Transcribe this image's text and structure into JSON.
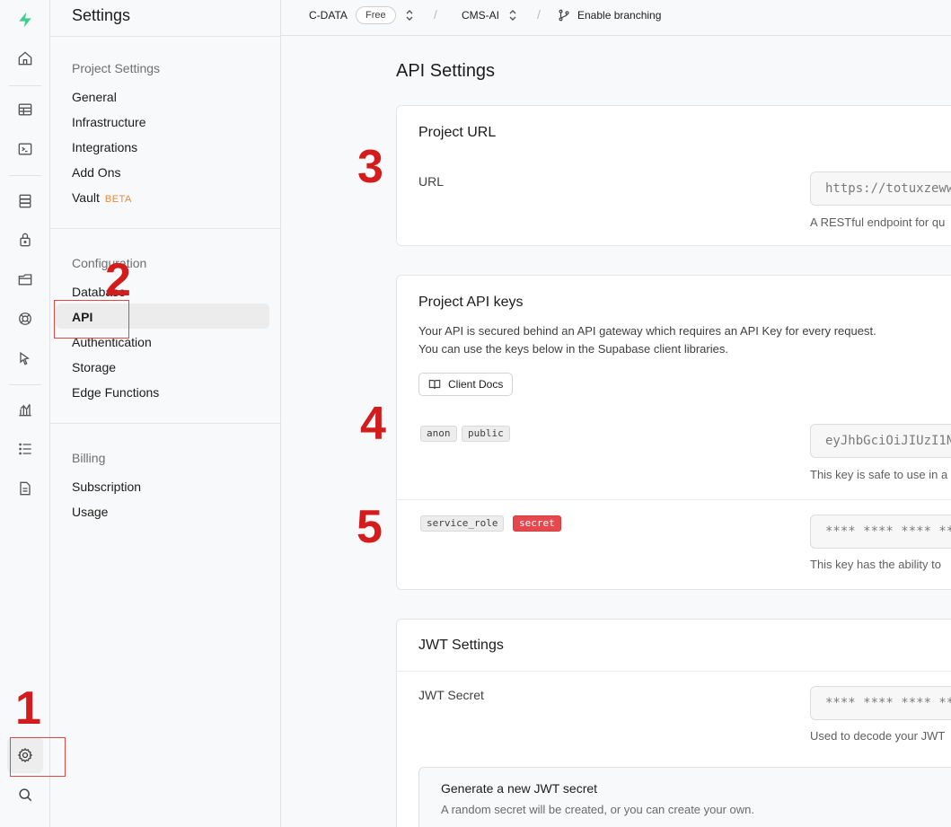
{
  "app": {
    "brand_color": "#3ecf8e"
  },
  "rail": {
    "icons": [
      "home-icon",
      "table-editor-icon",
      "sql-editor-icon",
      "database-icon",
      "auth-lock-icon",
      "storage-icon",
      "realtime-icon",
      "edge-functions-icon",
      "reports-icon",
      "logs-icon",
      "docs-icon",
      "settings-icon",
      "search-icon"
    ]
  },
  "menu": {
    "title": "Settings",
    "project_section": "Project Settings",
    "project_items": [
      "General",
      "Infrastructure",
      "Integrations",
      "Add Ons",
      "Vault"
    ],
    "vault_badge": "BETA",
    "config_section": "Configuration",
    "config_items": [
      "Database",
      "API",
      "Authentication",
      "Storage",
      "Edge Functions"
    ],
    "active_item": "API",
    "billing_section": "Billing",
    "billing_items": [
      "Subscription",
      "Usage"
    ]
  },
  "topbar": {
    "org": "C-DATA",
    "plan": "Free",
    "project": "CMS-AI",
    "branching": "Enable branching"
  },
  "main": {
    "title": "API Settings",
    "project_url": {
      "title": "Project URL",
      "label": "URL",
      "value": "https://totuxzeww",
      "help": "A RESTful endpoint for qu"
    },
    "api_keys": {
      "title": "Project API keys",
      "desc_1": "Your API is secured behind an API gateway which requires an API Key for every request.",
      "desc_2": "You can use the keys below in the Supabase client libraries.",
      "docs_button": "Client Docs",
      "anon_tags": [
        "anon",
        "public"
      ],
      "anon_value": "eyJhbGciOiJIUzI1N",
      "anon_help": "This key is safe to use in a",
      "service_tags": [
        "service_role",
        "secret"
      ],
      "service_value": "**** **** **** **",
      "service_help": "This key has the ability to"
    },
    "jwt": {
      "title": "JWT Settings",
      "label": "JWT Secret",
      "value": "**** **** **** **",
      "help": "Used to decode your JWT",
      "gen_title": "Generate a new JWT secret",
      "gen_desc": "A random secret will be created, or you can create your own."
    }
  },
  "annotations": {
    "color": "#d41c1c",
    "markers": [
      "1",
      "2",
      "3",
      "4",
      "5"
    ]
  }
}
